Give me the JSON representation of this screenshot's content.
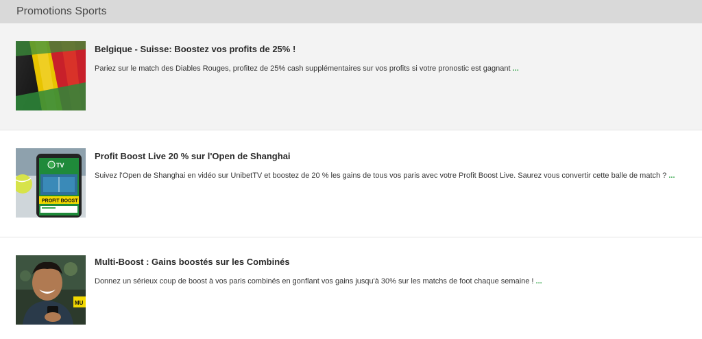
{
  "header": {
    "title": "Promotions Sports"
  },
  "promotions": [
    {
      "title": "Belgique - Suisse: Boostez vos profits de 25% !",
      "description": "Pariez sur le match des Diables Rouges, profitez de 25% cash supplémentaires sur vos profits si votre pronostic est gagnant",
      "more": "...",
      "image_icon": "belgian-flag-image"
    },
    {
      "title": "Profit Boost Live 20 % sur l'Open de Shanghai",
      "description": "Suivez l'Open de Shanghai en vidéo sur UnibetTV et boostez de 20 % les gains de tous vos paris avec votre Profit Boost Live. Saurez vous convertir cette balle de match ?",
      "more": "...",
      "image_icon": "tennis-phone-image",
      "image_text": {
        "tv": "TV",
        "boost": "PROFIT BOOST"
      }
    },
    {
      "title": "Multi-Boost : Gains boostés sur les Combinés",
      "description": "Donnez un sérieux coup de boost à vos paris combinés en gonflant vos gains jusqu'à 30% sur les matchs de foot chaque semaine !",
      "more": "...",
      "image_icon": "smiling-man-image",
      "image_text": {
        "badge": "MU"
      }
    }
  ],
  "colors": {
    "link_green": "#3aa94f",
    "header_bg": "#d9d9d9",
    "highlight_row": "#f3f3f3"
  }
}
